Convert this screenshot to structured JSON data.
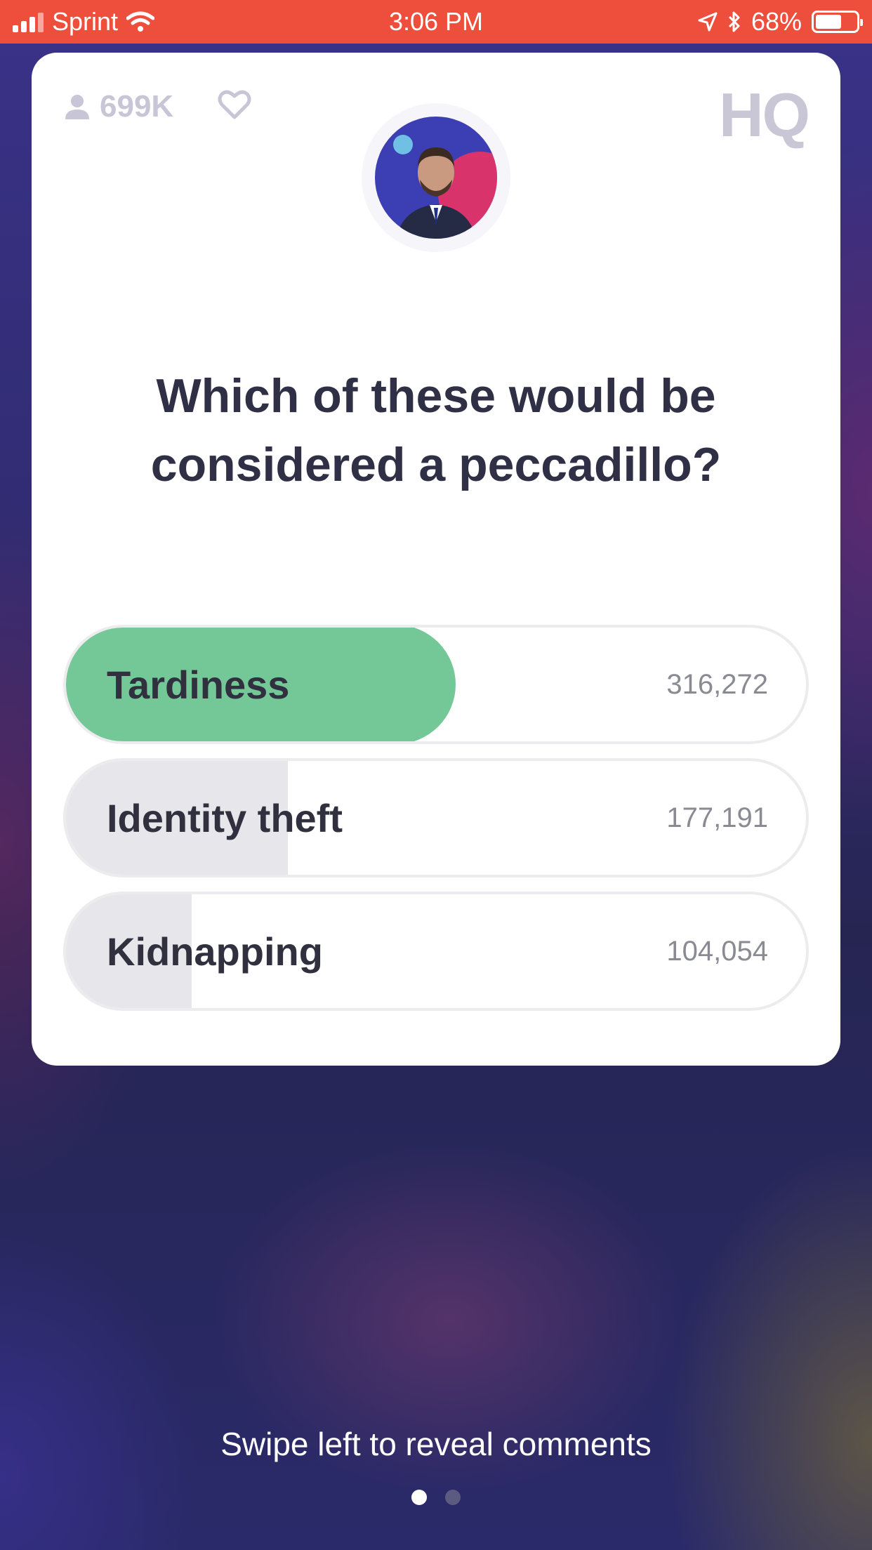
{
  "status_bar": {
    "carrier": "Sprint",
    "time": "3:06 PM",
    "battery_percent": "68%",
    "battery_level": 0.68,
    "icons": [
      "signal-icon",
      "wifi-icon",
      "location-arrow-icon",
      "bluetooth-icon",
      "battery-icon"
    ]
  },
  "game": {
    "viewer_count": "699K",
    "logo": "HQ",
    "question": "Which of these would be considered a peccadillo?",
    "answers": [
      {
        "label": "Tardiness",
        "count": "316,272",
        "share": 0.53,
        "correct": true
      },
      {
        "label": "Identity theft",
        "count": "177,191",
        "share": 0.3,
        "correct": false
      },
      {
        "label": "Kidnapping",
        "count": "104,054",
        "share": 0.17,
        "correct": false
      }
    ],
    "colors": {
      "correct": "#74c796",
      "header": "#ee4f3c"
    }
  },
  "footer": {
    "swipe_hint": "Swipe left to reveal comments",
    "page_index": 1,
    "page_count": 2
  }
}
